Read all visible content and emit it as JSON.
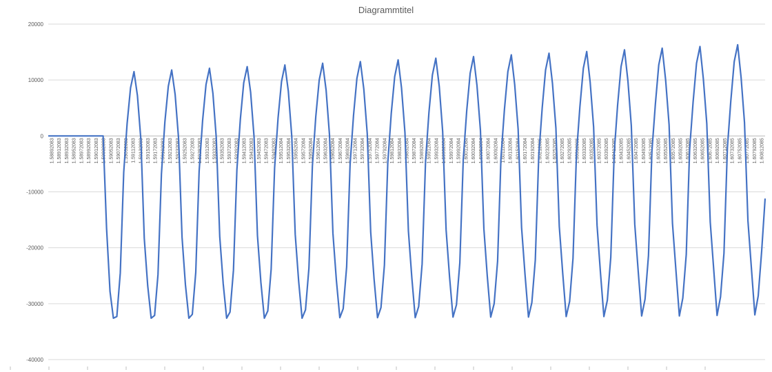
{
  "chart_data": {
    "type": "line",
    "title": "Diagrammtitel",
    "xlabel": "",
    "ylabel": "",
    "ylim": [
      -40000,
      20000
    ],
    "y_ticks": [
      20000,
      10000,
      0,
      -10000,
      -20000,
      -30000,
      -40000
    ],
    "grid": true,
    "legend": "none",
    "color": "#4472C4",
    "x_tick_labels": [
      "1.58892083",
      "1.58912083",
      "1.58932083",
      "1.58952083",
      "1.58972083",
      "1.58992083",
      "1.59012083",
      "1.59032083",
      "1.59052083",
      "1.59072083",
      "1.59092083",
      "1.59112083",
      "1.59132083",
      "1.59152083",
      "1.59172083",
      "1.59192083",
      "1.59212083",
      "1.59232083",
      "1.59252083",
      "1.59272083",
      "1.59292083",
      "1.59312083",
      "1.59332083",
      "1.59352083",
      "1.59372083",
      "1.59392083",
      "1.59412083",
      "1.59432083",
      "1.59452083",
      "1.59472083",
      "1.59492083",
      "1.59512084",
      "1.59532084",
      "1.59552084",
      "1.59572084",
      "1.59592084",
      "1.59612084",
      "1.59632084",
      "1.59652084",
      "1.59672084",
      "1.59692084",
      "1.59712084",
      "1.59732084",
      "1.59752084",
      "1.59772084",
      "1.59792084",
      "1.59812084",
      "1.59832084",
      "1.59852084",
      "1.59872084",
      "1.59892084",
      "1.59912084",
      "1.59932084",
      "1.59952084",
      "1.59972084",
      "1.59992084",
      "1.60012084",
      "1.60032084",
      "1.60052084",
      "1.60072084",
      "1.60092084",
      "1.60112084",
      "1.60132084",
      "1.60152084",
      "1.60172084",
      "1.60192084",
      "1.60212085",
      "1.60232085",
      "1.60252085",
      "1.60272085",
      "1.60292085",
      "1.60312085",
      "1.60332085",
      "1.60352085",
      "1.60372085",
      "1.60392085",
      "1.60412085",
      "1.60432085",
      "1.60452085",
      "1.60472085",
      "1.60492085",
      "1.60512085",
      "1.60532085",
      "1.60552085",
      "1.60572085",
      "1.60592085",
      "1.60612085",
      "1.60632085",
      "1.60652085",
      "1.60672085",
      "1.60692085",
      "1.60712085",
      "1.60732085",
      "1.60752085",
      "1.60772085",
      "1.60792085",
      "1.60812085"
    ],
    "series": [
      {
        "y": [
          0,
          0,
          0,
          0,
          0,
          0,
          0,
          0,
          0,
          0,
          0,
          0,
          0,
          0,
          0,
          0,
          0,
          -16500,
          -27800,
          -32600,
          -32300,
          -24500,
          -6500,
          2200,
          8600,
          11500,
          7200,
          -700,
          -18300,
          -26800,
          -32600,
          -32100,
          -24800,
          -6800,
          2500,
          8900,
          11800,
          7400,
          -500,
          -18100,
          -26600,
          -32600,
          -31900,
          -24400,
          -6300,
          2700,
          9200,
          12100,
          7600,
          -400,
          -18000,
          -26400,
          -32600,
          -31500,
          -24000,
          -6000,
          3000,
          9500,
          12400,
          7800,
          -200,
          -17800,
          -26200,
          -32600,
          -31300,
          -23800,
          -5700,
          3200,
          9700,
          12700,
          8000,
          -100,
          -17600,
          -26000,
          -32600,
          -31100,
          -23600,
          -5400,
          3400,
          10000,
          13000,
          8200,
          200,
          -17400,
          -25800,
          -32500,
          -30900,
          -23400,
          -5100,
          3700,
          10300,
          13300,
          8400,
          400,
          -17200,
          -25600,
          -32500,
          -30700,
          -23100,
          -4800,
          4000,
          10600,
          13600,
          8600,
          600,
          -17000,
          -25400,
          -32500,
          -30500,
          -22900,
          -4500,
          4200,
          10900,
          13900,
          8800,
          800,
          -16800,
          -25200,
          -32400,
          -30200,
          -22700,
          -4200,
          4500,
          11200,
          14200,
          9000,
          1000,
          -16600,
          -25000,
          -32400,
          -30000,
          -22400,
          -3900,
          4700,
          11500,
          14500,
          9200,
          1200,
          -16400,
          -24800,
          -32400,
          -29800,
          -22200,
          -3600,
          5000,
          11800,
          14800,
          9400,
          1400,
          -16200,
          -24600,
          -32300,
          -29600,
          -21900,
          -3300,
          5200,
          12100,
          15100,
          9600,
          1600,
          -16000,
          -24400,
          -32300,
          -29400,
          -21700,
          -3000,
          5500,
          12400,
          15400,
          9800,
          1800,
          -15800,
          -24200,
          -32200,
          -29200,
          -21400,
          -2700,
          5700,
          12700,
          15700,
          10000,
          2000,
          -15600,
          -24000,
          -32200,
          -29000,
          -21200,
          -2400,
          6000,
          13000,
          16000,
          10200,
          2200,
          -15400,
          -23800,
          -32100,
          -28800,
          -21000,
          -2100,
          6200,
          13300,
          16300,
          10400,
          2400,
          -15200,
          -23600,
          -32000,
          -28600,
          -20600,
          -11200
        ]
      }
    ]
  }
}
